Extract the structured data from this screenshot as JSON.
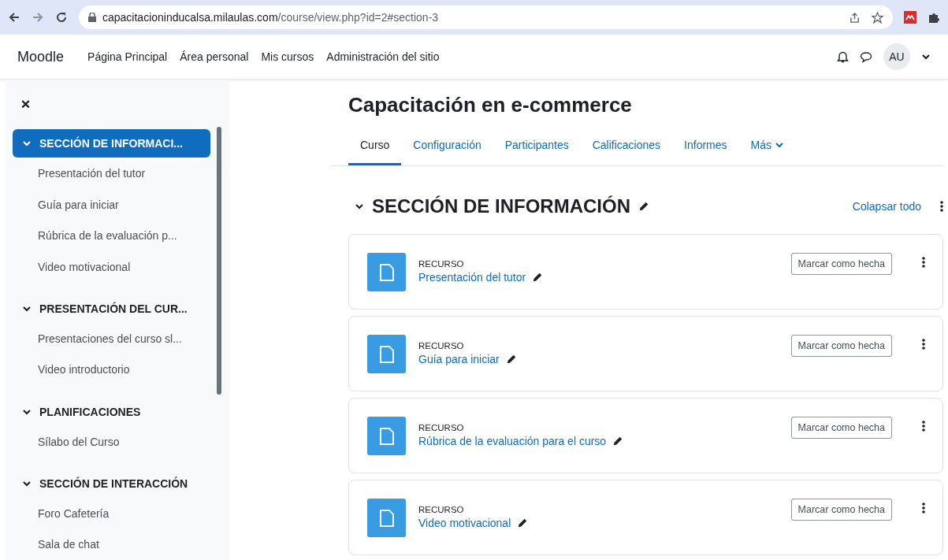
{
  "browser": {
    "url_host": "capacitacioninducalsa.milaulas.com",
    "url_path": "/course/view.php?id=2#section-3"
  },
  "navbar": {
    "brand": "Moodle",
    "links": [
      {
        "label": "Página Principal"
      },
      {
        "label": "Área personal"
      },
      {
        "label": "Mis cursos"
      },
      {
        "label": "Administración del sitio"
      }
    ],
    "avatar": "AU"
  },
  "sidebar": {
    "sections": [
      {
        "title": "SECCIÓN DE INFORMACI...",
        "selected": true,
        "expanded": true,
        "children": [
          {
            "label": "Presentación del tutor"
          },
          {
            "label": "Guía para iniciar"
          },
          {
            "label": "Rúbrica de la evaluación p..."
          },
          {
            "label": "Video motivacional"
          }
        ]
      },
      {
        "title": "PRESENTACIÓN DEL CUR...",
        "selected": false,
        "expanded": true,
        "children": [
          {
            "label": "Presentaciones del curso sl..."
          },
          {
            "label": "Video introductorio"
          }
        ]
      },
      {
        "title": "PLANIFICACIONES",
        "selected": false,
        "expanded": true,
        "children": [
          {
            "label": "Sílabo del Curso"
          }
        ]
      },
      {
        "title": "SECCIÓN DE INTERACCIÓN",
        "selected": false,
        "expanded": true,
        "children": [
          {
            "label": "Foro Cafetería"
          },
          {
            "label": "Sala de chat"
          }
        ]
      }
    ]
  },
  "course": {
    "title": "Capacitación en e-commerce",
    "tabs": [
      {
        "label": "Curso",
        "selected": true
      },
      {
        "label": "Configuración",
        "selected": false
      },
      {
        "label": "Participantes",
        "selected": false
      },
      {
        "label": "Calificaciones",
        "selected": false
      },
      {
        "label": "Informes",
        "selected": false
      },
      {
        "label": "Más",
        "selected": false
      }
    ],
    "section": {
      "title": "SECCIÓN DE INFORMACIÓN",
      "expanded": true,
      "collapse_all": "Colapsar todo"
    },
    "activities": [
      {
        "type": "RECURSO",
        "name": "Presentación del tutor",
        "button": "Marcar como hecha"
      },
      {
        "type": "RECURSO",
        "name": "Guía para iniciar",
        "button": "Marcar como hecha"
      },
      {
        "type": "RECURSO",
        "name": "Rúbrica de la evaluación para el curso",
        "button": "Marcar como hecha"
      },
      {
        "type": "RECURSO",
        "name": "Video motivacional",
        "button": "Marcar como hecha"
      }
    ]
  }
}
